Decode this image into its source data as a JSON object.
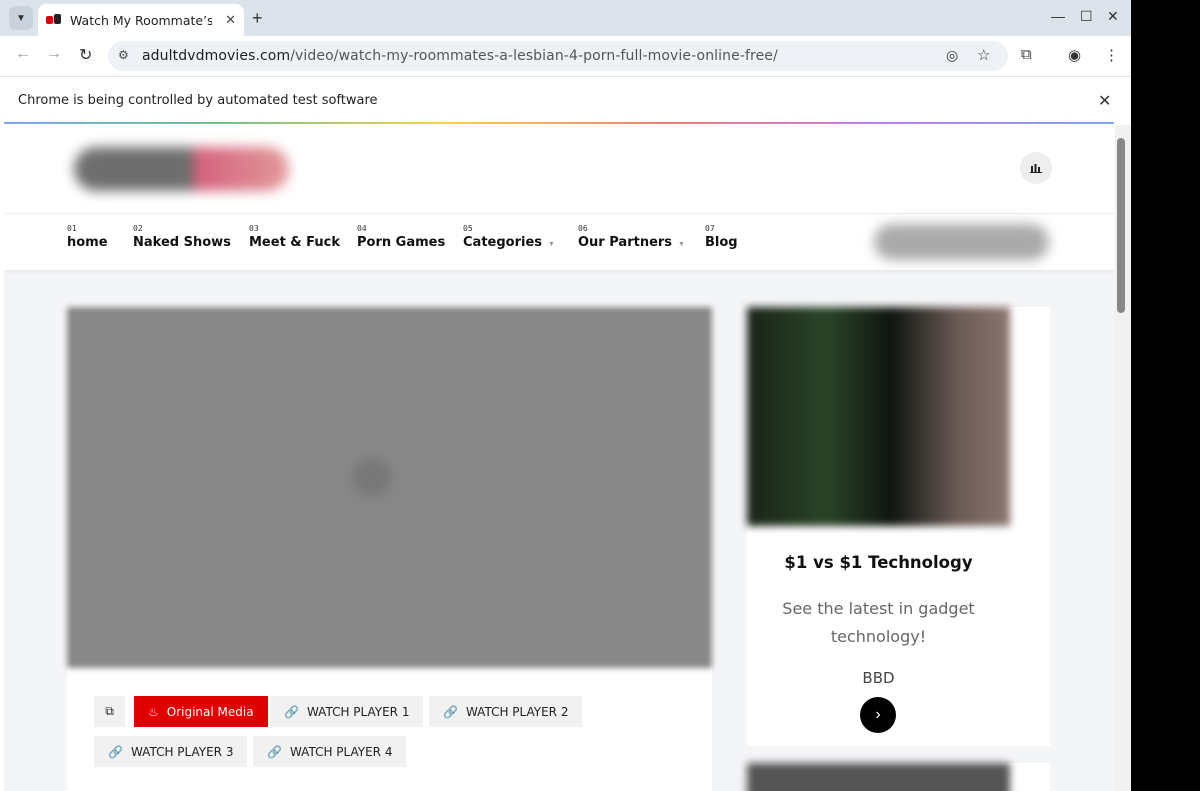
{
  "browser": {
    "tab_title": "Watch My Roommate’s A",
    "url_domain": "adultdvdmovies.com",
    "url_path": "/video/watch-my-roommates-a-lesbian-4-porn-full-movie-online-free/",
    "infobar_text": "Chrome is being controlled by automated test software"
  },
  "nav": {
    "items": [
      {
        "num": "01",
        "label": "home"
      },
      {
        "num": "02",
        "label": "Naked Shows"
      },
      {
        "num": "03",
        "label": "Meet & Fuck"
      },
      {
        "num": "04",
        "label": "Porn Games"
      },
      {
        "num": "05",
        "label": "Categories"
      },
      {
        "num": "06",
        "label": "Our Partners"
      },
      {
        "num": "07",
        "label": "Blog"
      }
    ]
  },
  "player": {
    "sources": {
      "original": "Original Media",
      "p1": "WATCH PLAYER 1",
      "p2": "WATCH PLAYER 2",
      "p3": "WATCH PLAYER 3",
      "p4": "WATCH PLAYER 4"
    }
  },
  "ad": {
    "title": "$1 vs $1 Technology",
    "description": "See the latest in gadget technology!",
    "brand": "BBD"
  },
  "colors": {
    "accent": "#e10000",
    "page_bg": "#f4f5f7"
  }
}
